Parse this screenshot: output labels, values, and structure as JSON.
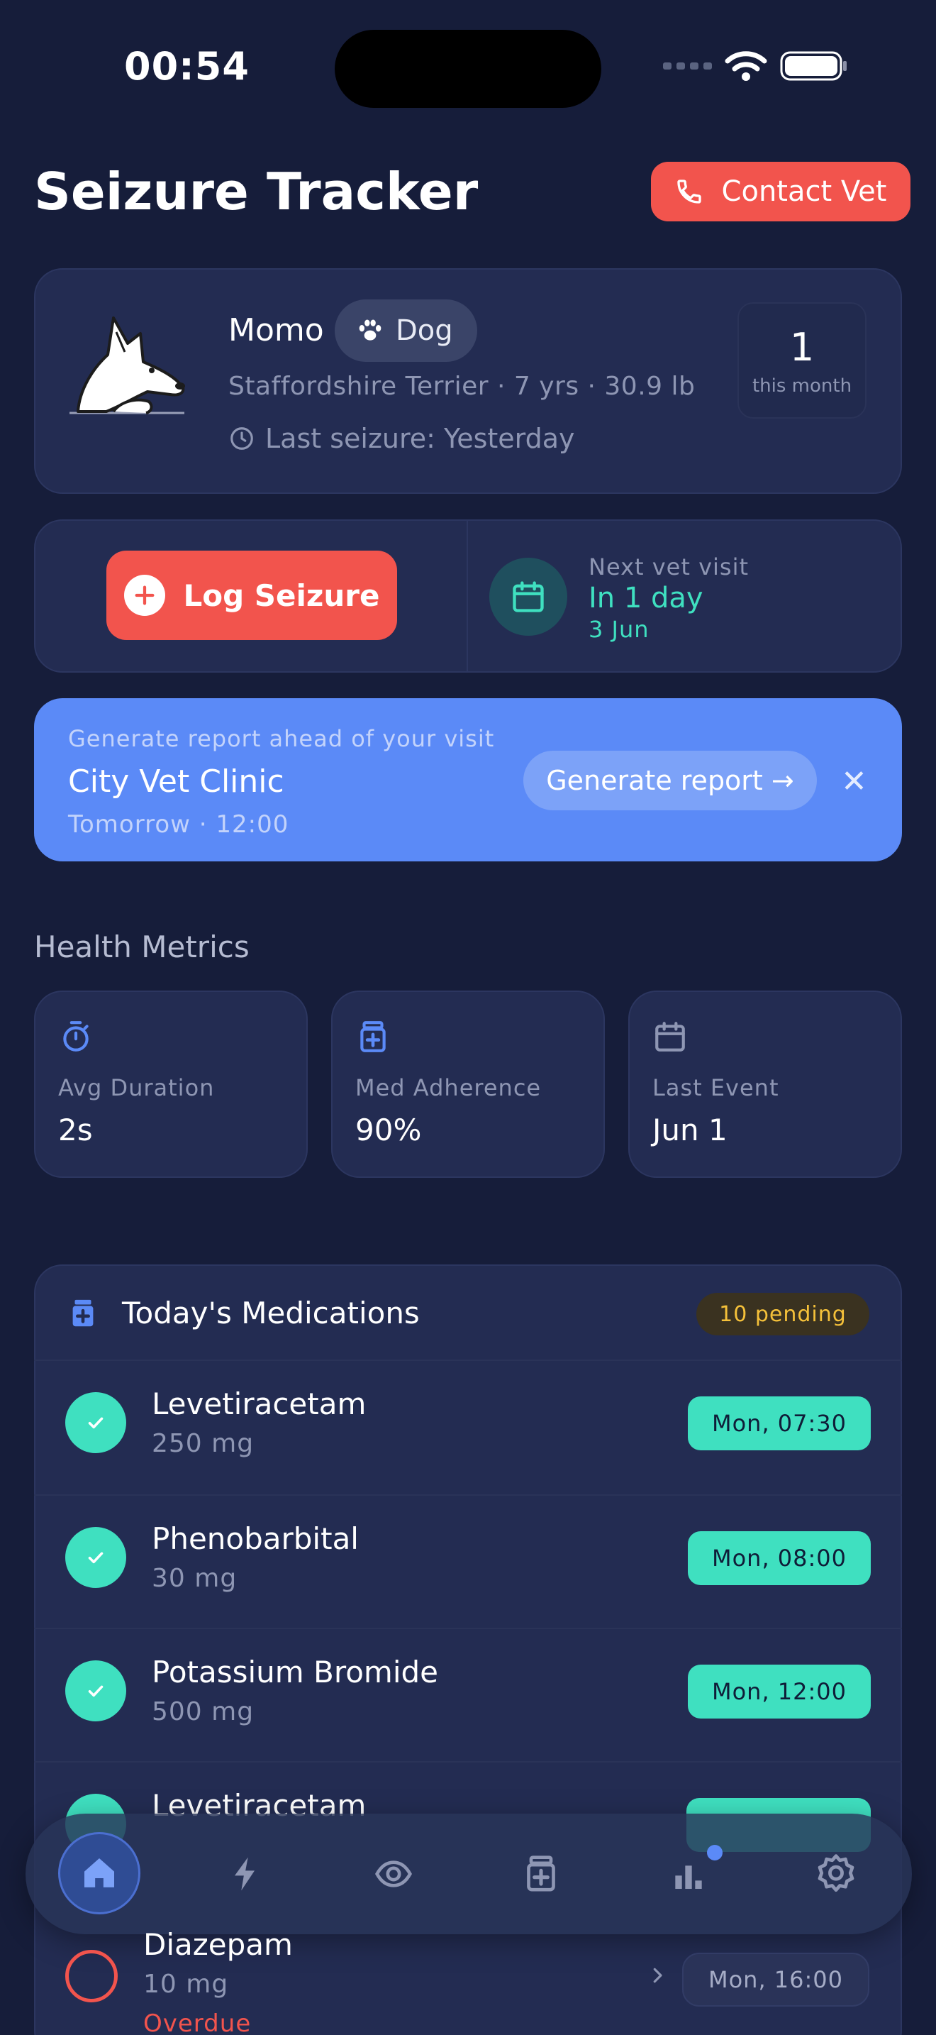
{
  "status_bar": {
    "time": "00:54"
  },
  "header": {
    "title": "Seizure Tracker",
    "contact_label": "Contact Vet"
  },
  "pet": {
    "name": "Momo",
    "species": "Dog",
    "details": "Staffordshire Terrier · 7 yrs · 30.9 lb",
    "last_seizure": "Last seizure: Yesterday",
    "count": "1",
    "count_label": "this month"
  },
  "actions": {
    "log_label": "Log Seizure",
    "next_visit_label": "Next vet visit",
    "next_visit_when": "In 1 day",
    "next_visit_date": "3 Jun"
  },
  "report": {
    "label": "Generate report ahead of your visit",
    "clinic": "City Vet Clinic",
    "time": "Tomorrow · 12:00",
    "button_label": "Generate report →",
    "close_glyph": "✕"
  },
  "metrics": {
    "title": "Health Metrics",
    "items": [
      {
        "icon": "stopwatch-icon",
        "label": "Avg Duration",
        "value": "2s"
      },
      {
        "icon": "medication-icon",
        "label": "Med Adherence",
        "value": "90%"
      },
      {
        "icon": "calendar-icon",
        "label": "Last Event",
        "value": "Jun 1"
      }
    ]
  },
  "medications": {
    "title": "Today's Medications",
    "pending": "10 pending",
    "items": [
      {
        "name": "Levetiracetam",
        "dose": "250 mg",
        "time": "Mon, 07:30"
      },
      {
        "name": "Phenobarbital",
        "dose": "30 mg",
        "time": "Mon, 08:00"
      },
      {
        "name": "Potassium Bromide",
        "dose": "500 mg",
        "time": "Mon, 12:00"
      },
      {
        "name": "Levetiracetam",
        "dose": "",
        "time": ""
      }
    ],
    "overdue": {
      "name": "Diazepam",
      "dose": "10 mg",
      "status": "Overdue",
      "time": "Mon, 16:00"
    }
  },
  "tabs": [
    "home-icon",
    "bolt-icon",
    "eye-icon",
    "medication-icon",
    "chart-icon",
    "settings-icon"
  ],
  "colors": {
    "background": "#161d3a",
    "card": "#232c52",
    "accent_red": "#f2544d",
    "accent_blue": "#5b8af7",
    "accent_teal": "#3fe0c0",
    "pending_yellow": "#f5c13a"
  }
}
